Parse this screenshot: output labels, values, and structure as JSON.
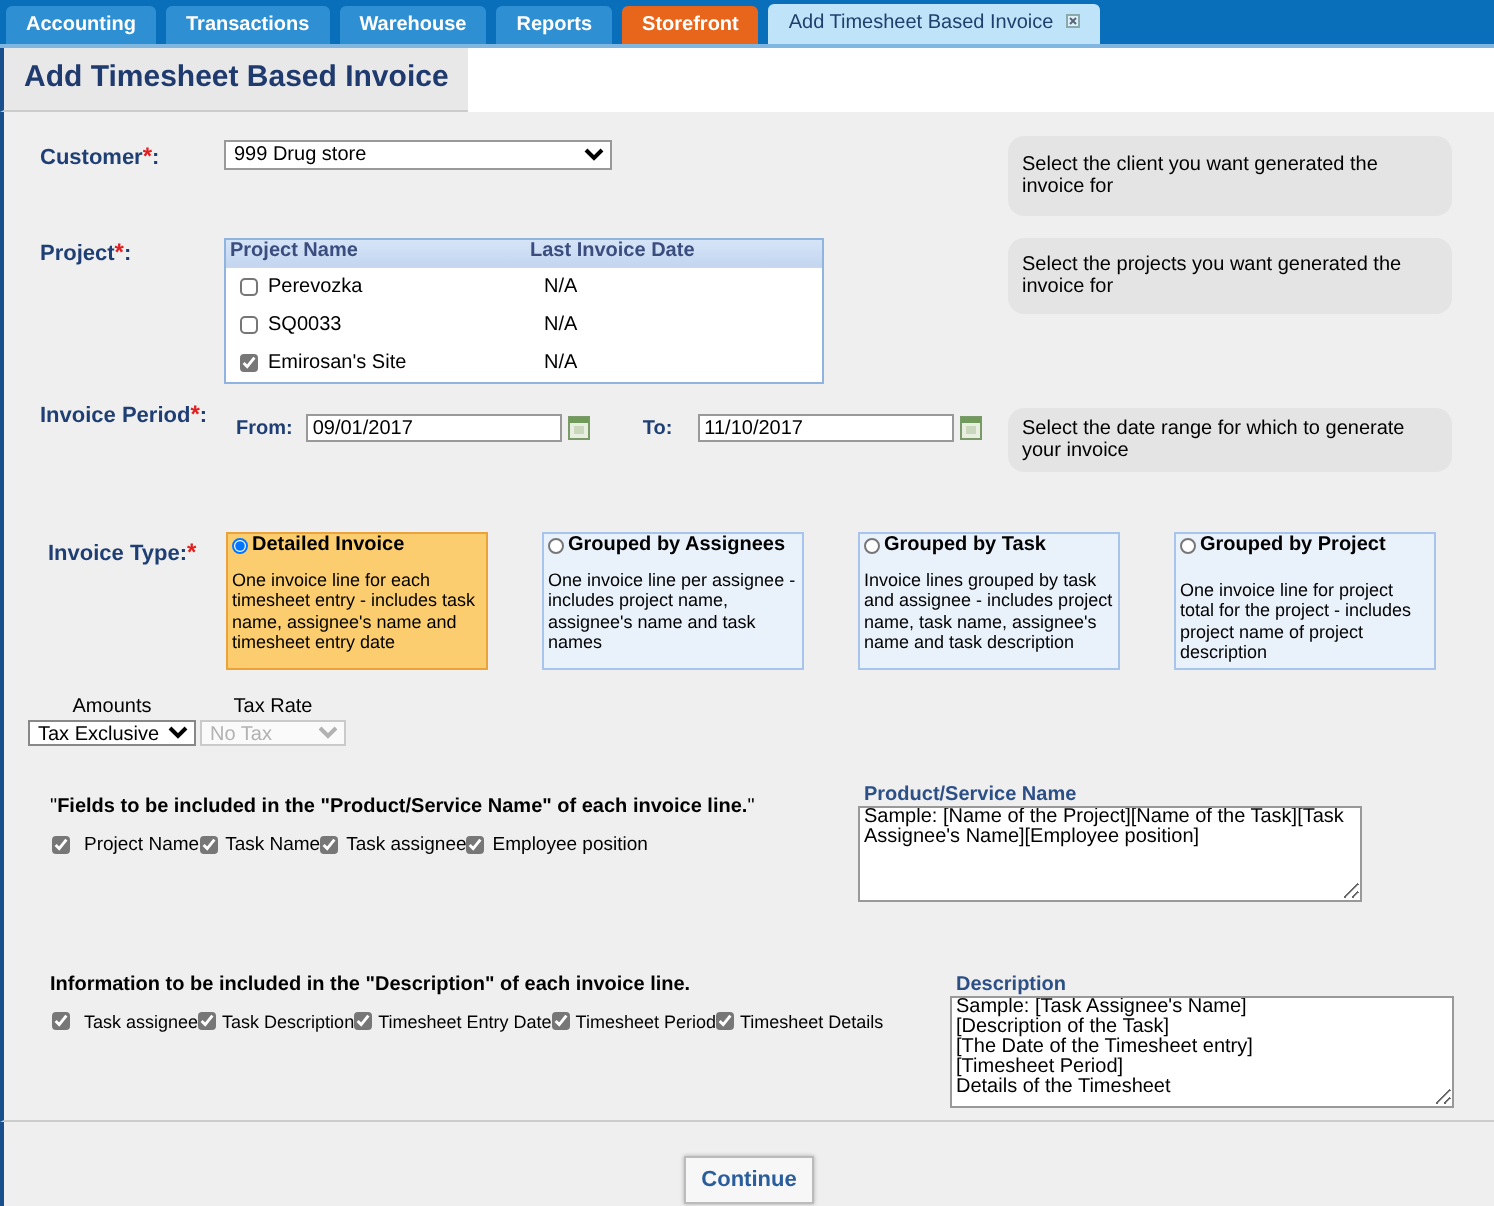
{
  "tabs": [
    {
      "label": "Accounting",
      "kind": "normal",
      "selected": false
    },
    {
      "label": "Transactions",
      "kind": "normal",
      "selected": false
    },
    {
      "label": "Warehouse",
      "kind": "normal",
      "selected": false
    },
    {
      "label": "Reports",
      "kind": "normal",
      "selected": false
    },
    {
      "label": "Storefront",
      "kind": "highlight",
      "selected": false
    },
    {
      "label": "Add Timesheet Based Invoice",
      "kind": "normal",
      "selected": true
    }
  ],
  "page_title": "Add Timesheet Based Invoice",
  "customer": {
    "label": "Customer",
    "mark": "*",
    "suffix": ":",
    "value": "999 Drug store",
    "help": "Select the client you want generated the invoice for"
  },
  "project": {
    "label": "Project",
    "mark": "*",
    "suffix": ":",
    "columns": [
      "Project Name",
      "Last Invoice Date"
    ],
    "rows": [
      {
        "name": "Perevozka",
        "last_invoice_date": "N/A",
        "checked": false
      },
      {
        "name": "SQ0033",
        "last_invoice_date": "N/A",
        "checked": false
      },
      {
        "name": "Emirosan's Site",
        "last_invoice_date": "N/A",
        "checked": true
      }
    ],
    "help": "Select the projects you want generated the invoice for"
  },
  "invoice_period": {
    "label": "Invoice Period",
    "mark": "*",
    "suffix": ":",
    "from_label": "From:",
    "from_value": "09/01/2017",
    "to_label": "To:",
    "to_value": "11/10/2017",
    "help": "Select the date range for which to generate your invoice"
  },
  "invoice_type": {
    "label": "Invoice Type:",
    "mark": "*",
    "options": [
      {
        "title": "Detailed Invoice",
        "description": "One invoice line for each timesheet entry - includes task name, assignee's name and timesheet entry date",
        "selected": true
      },
      {
        "title": "Grouped by Assignees",
        "description": "One invoice line per assignee - includes project name, assignee's name and task names",
        "selected": false
      },
      {
        "title": "Grouped by Task",
        "description": "Invoice lines grouped by task and assignee - includes project name, task name, assignee's name and task description",
        "selected": false
      },
      {
        "title": "Grouped by Project",
        "description": "One invoice line for project total for the project - includes project name of project description",
        "selected": false
      }
    ]
  },
  "amounts": {
    "label": "Amounts",
    "value": "Tax Exclusive"
  },
  "tax_rate": {
    "label": "Tax Rate",
    "value": "No Tax",
    "disabled": true
  },
  "product_fields": {
    "heading": "\"**Fields to be included in the \"Product/Service Name\" of each invoice line.**\"",
    "checkboxes": [
      {
        "label": "Project Name",
        "checked": true
      },
      {
        "label": "Task Name",
        "checked": true
      },
      {
        "label": "Task assignee",
        "checked": true
      },
      {
        "label": "Employee position",
        "checked": true
      }
    ],
    "sample_label": "Product/Service Name",
    "sample": "Sample: [Name of the Project][Name of the Task][Task Assignee's Name][Employee position]"
  },
  "description_fields": {
    "heading": "Information to be included in the \"Description\" of each invoice line.",
    "checkboxes": [
      {
        "label": "Task assignee",
        "checked": true
      },
      {
        "label": "Task Description",
        "checked": true
      },
      {
        "label": "Timesheet Entry Date",
        "checked": true
      },
      {
        "label": "Timesheet Period",
        "checked": true
      },
      {
        "label": "Timesheet Details",
        "checked": true
      }
    ],
    "sample_label": "Description",
    "sample": "Sample: [Task Assignee's Name]\n[Description of the Task]\n[The Date of the Timesheet entry]\n[Timesheet Period]\nDetails of the Timesheet"
  },
  "continue_button": "Continue"
}
